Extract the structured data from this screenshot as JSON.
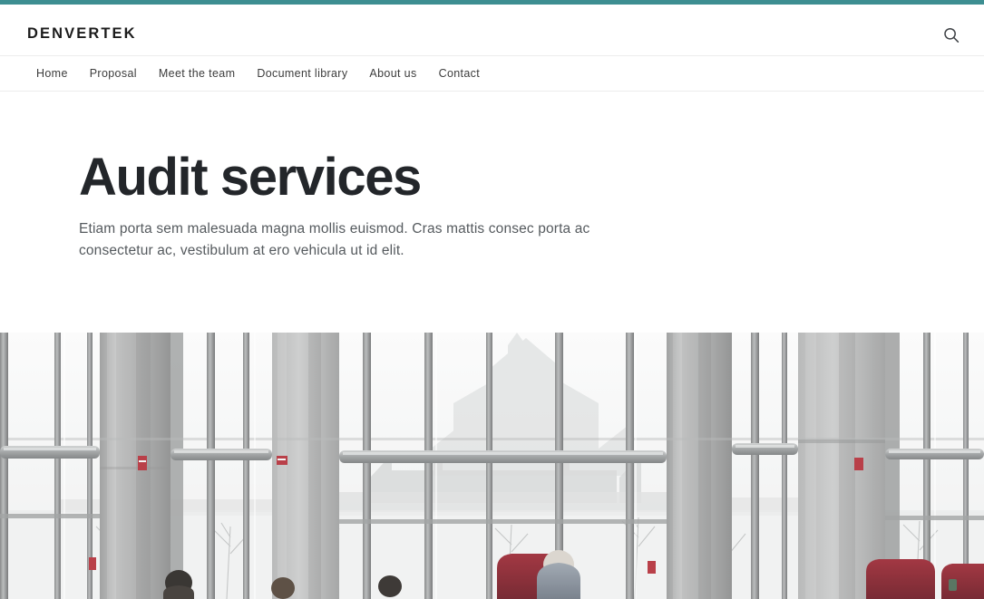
{
  "theme": {
    "accent_color": "#3d8e91",
    "text_dark": "#23262a",
    "text_body": "#555a5e",
    "nav_text": "#3c3c3c",
    "border": "#ececec",
    "page_background": "#ffffff"
  },
  "header": {
    "brand": "DENVERTEK",
    "search_icon": "search-icon"
  },
  "nav": {
    "items": [
      {
        "label": "Home"
      },
      {
        "label": "Proposal"
      },
      {
        "label": "Meet the team"
      },
      {
        "label": "Document library"
      },
      {
        "label": "About us"
      },
      {
        "label": "Contact"
      }
    ]
  },
  "hero": {
    "title": "Audit services",
    "subtitle": "Etiam porta sem malesuada magna mollis euismod. Cras mattis consec porta ac consectetur ac, vestibulum at ero vehicula ut id elit.",
    "image_alt": "Interior of a modern concrete and glass atrium looking out through tall windows onto a gothic revival building and bare winter trees, with seated people and red chairs in the foreground"
  }
}
